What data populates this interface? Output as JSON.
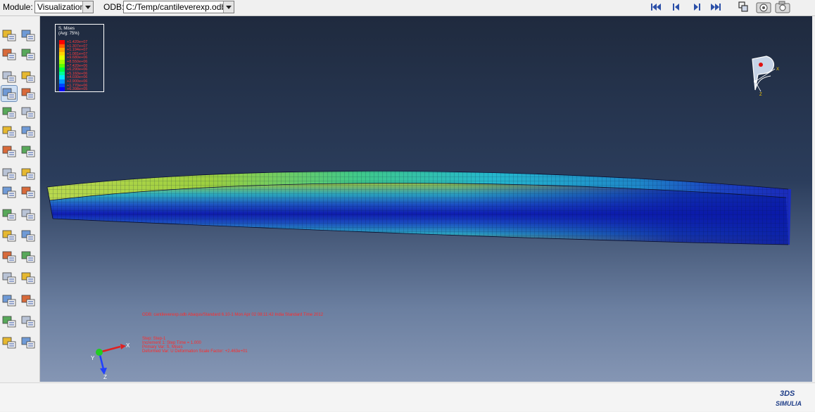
{
  "toolbar": {
    "module_label": "Module:",
    "module_value": "Visualization",
    "odb_label": "ODB:",
    "odb_value": "C:/Temp/cantileverexp.odb",
    "anim_buttons": [
      "first-frame-icon",
      "previous-frame-icon",
      "next-frame-icon",
      "last-frame-icon"
    ],
    "view_buttons": [
      "overlay-icon",
      "camera-settings-icon",
      "camera-icon"
    ]
  },
  "left_toolbox": {
    "tools": [
      "result-options-icon",
      "field-output-icon",
      "common-options-icon",
      "superimpose-icon",
      "undeformed-shape-icon",
      "deformed-shape-icon",
      "contour-plot-icon",
      "contour-options-icon",
      "symbol-plot-icon",
      "symbol-options-icon",
      "material-orientation-icon",
      "orientation-options-icon",
      "allow-multiple-plots-icon",
      "animate-scale-factor-icon",
      "animate-time-history-icon",
      "animation-options-icon",
      "xy-data-manager-icon",
      "create-xy-data-icon",
      "create-path-icon",
      "xy-plot-icon",
      "probe-values-icon",
      "report-field-icon",
      "display-group-icon",
      "replace-group-icon",
      "stream-icon",
      "stream-manager-icon",
      "free-body-cut-icon",
      "view-cut-manager-icon",
      "query-icon",
      "query-manager-icon",
      "restart-output-icon",
      "output-manager-icon"
    ]
  },
  "legend": {
    "title_line1": "S, Mises",
    "title_line2": "(Avg: 75%)",
    "colors": [
      "#ff0000",
      "#ff5a00",
      "#ffa500",
      "#ffd400",
      "#e2ff00",
      "#a6ff00",
      "#5cff00",
      "#00ff3f",
      "#00ff9a",
      "#00eaff",
      "#0093ff",
      "#0044ff",
      "#0000ff"
    ],
    "values": [
      "+1.420e+07",
      "+1.307e+07",
      "+1.194e+07",
      "+1.081e+07",
      "+9.680e+06",
      "+8.550e+06",
      "+7.420e+06",
      "+6.290e+06",
      "+5.160e+06",
      "+4.030e+06",
      "+2.900e+06",
      "+1.770e+06",
      "+6.398e+05"
    ]
  },
  "info": {
    "odb_line": "ODB: cantileverexp.odb    Abaqus/Standard 6.10-1    Mon Apr 02 08:11:42 India Standard Time 2012",
    "step_line": "Step: Step-1",
    "increment_line": "Increment      1: Step Time =    1.000",
    "primary_var_line": "Primary Var: S, Mises",
    "deformed_var_line": "Deformed Var: U   Deformation Scale Factor: +2.463e+01"
  },
  "triad": {
    "x_label": "X",
    "y_label": "Y",
    "z_label": "Z",
    "x_color": "#e02020",
    "y_color": "#22cc22",
    "z_color": "#2040ff"
  },
  "compass": {
    "x_label": "X",
    "z_label": "Z"
  },
  "brand": {
    "logo_text": "SIMULIA",
    "logo_mark": "3DS"
  }
}
